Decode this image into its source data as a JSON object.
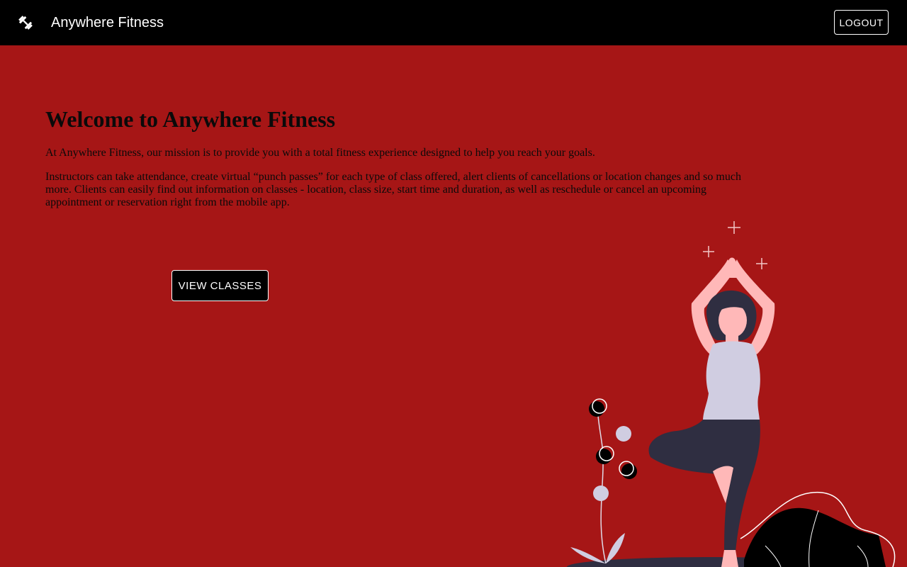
{
  "header": {
    "logo_icon": "dumbbell-icon",
    "app_title": "Anywhere Fitness",
    "logout_label": "LOGOUT"
  },
  "hero": {
    "title": "Welcome to Anywhere Fitness",
    "paragraph1": "At Anywhere Fitness, our mission is to provide you with a total fitness experience designed to help you reach your goals.",
    "paragraph2": "Instructors can take attendance, create virtual “punch passes” for each type of class offered, alert clients of cancellations or location changes and so much more. Clients can easily find out information on classes - location, class size, start time and duration, as well as reschedule or cancel an upcoming appointment or reservation right from the mobile app.",
    "cta_label": "VIEW CLASSES"
  },
  "colors": {
    "background": "#a61616",
    "header": "#000000",
    "button_bg": "#000000",
    "button_text": "#ffffff",
    "figure_skin": "#ffb8b8",
    "figure_hair": "#2f2e41",
    "figure_top": "#d0cde1",
    "figure_pants": "#2f2e41"
  },
  "illustration": {
    "subject": "woman-yoga-tree-pose"
  }
}
